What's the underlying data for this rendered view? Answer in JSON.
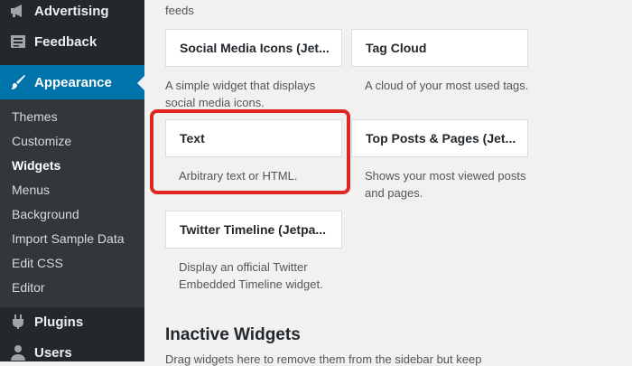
{
  "sidebar": {
    "top_items": [
      {
        "label": "Advertising",
        "icon": "megaphone-icon"
      },
      {
        "label": "Feedback",
        "icon": "feedback-icon"
      }
    ],
    "active": {
      "label": "Appearance",
      "icon": "paintbrush-icon"
    },
    "submenu": [
      "Themes",
      "Customize",
      "Widgets",
      "Menus",
      "Background",
      "Import Sample Data",
      "Edit CSS",
      "Editor"
    ],
    "current_submenu": "Widgets",
    "bottom_items": [
      {
        "label": "Plugins",
        "icon": "plugin-icon"
      },
      {
        "label": "Users",
        "icon": "user-icon"
      }
    ],
    "colors": {
      "bg": "#23282d",
      "active": "#0073aa",
      "submenu_bg": "#32373c"
    }
  },
  "main": {
    "top_fragment": "feeds",
    "widgets": [
      {
        "title": "Social Media Icons (Jet...",
        "description": "A simple widget that displays social media icons."
      },
      {
        "title": "Tag Cloud",
        "description": "A cloud of your most used tags."
      },
      {
        "title": "Text",
        "description": "Arbitrary text or HTML."
      },
      {
        "title": "Top Posts & Pages (Jet...",
        "description": "Shows your most viewed posts and pages."
      },
      {
        "title": "Twitter Timeline (Jetpa...",
        "description": "Display an official Twitter Embedded Timeline widget."
      }
    ],
    "inactive_title": "Inactive Widgets",
    "inactive_desc": "Drag widgets here to remove them from the sidebar but keep",
    "highlight_color": "#e0261e"
  }
}
